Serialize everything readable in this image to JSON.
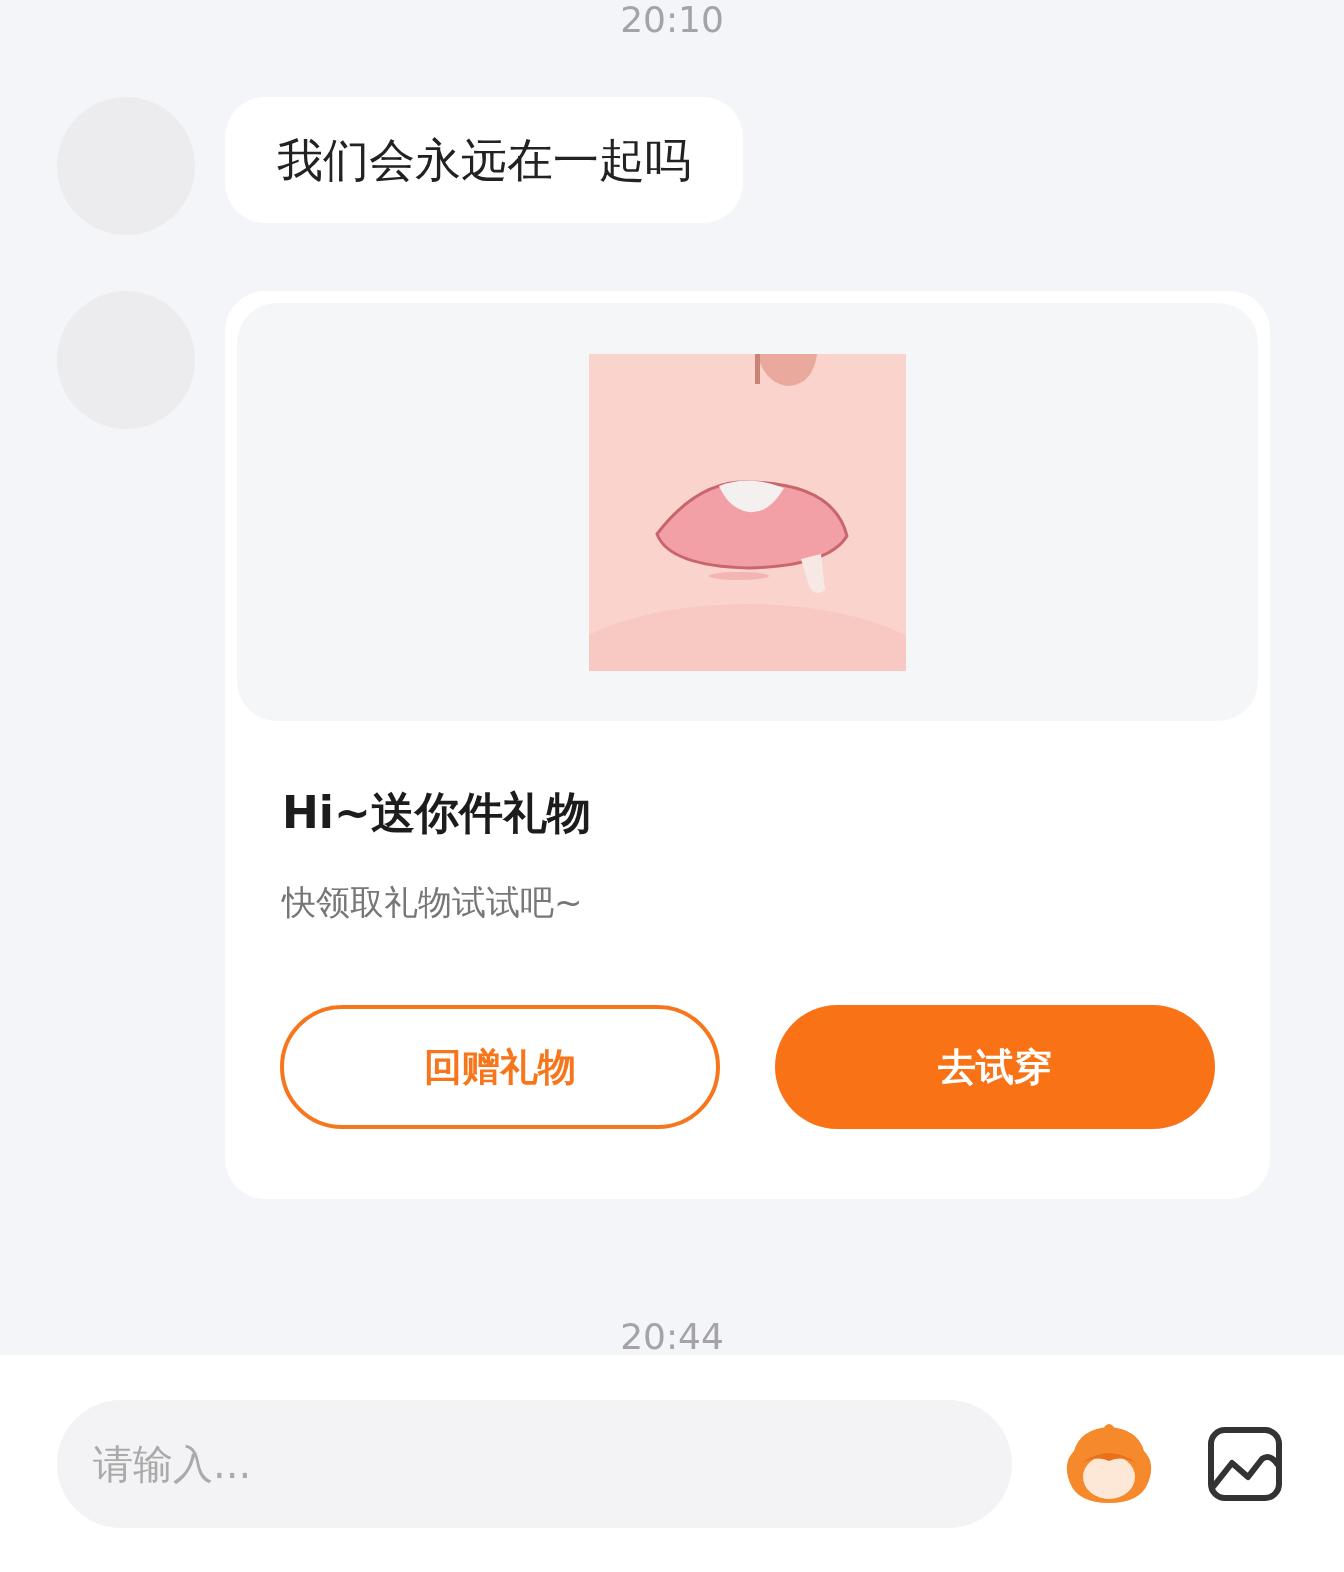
{
  "messages": [
    {
      "kind": "time",
      "text": "20:10"
    },
    {
      "kind": "text",
      "text": "我们会永远在一起吗"
    },
    {
      "kind": "gift",
      "title": "Hi~送你件礼物",
      "subtitle": "快领取礼物试试吧~",
      "buttons": [
        {
          "label": "回赠礼物",
          "kind": "outline"
        },
        {
          "label": "去试穿",
          "kind": "solid"
        }
      ]
    },
    {
      "kind": "time",
      "text": "20:44"
    }
  ],
  "composer": {
    "placeholder": "请输入..."
  }
}
